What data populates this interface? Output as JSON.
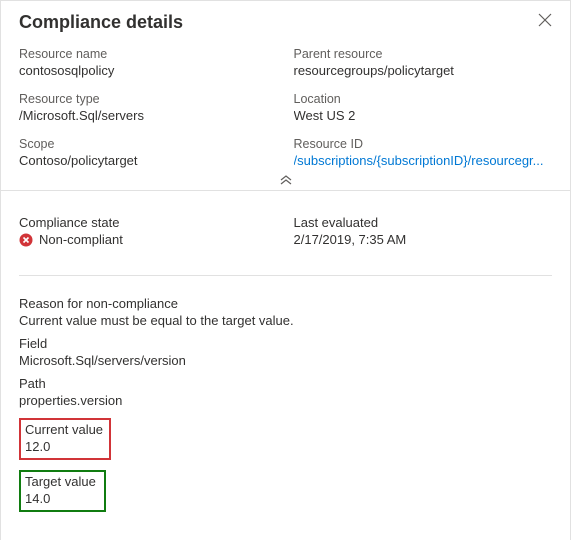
{
  "header": {
    "title": "Compliance details"
  },
  "details": {
    "resource_name": {
      "label": "Resource name",
      "value": "contososqlpolicy"
    },
    "parent_resource": {
      "label": "Parent resource",
      "value": "resourcegroups/policytarget"
    },
    "resource_type": {
      "label": "Resource type",
      "value": "/Microsoft.Sql/servers"
    },
    "location": {
      "label": "Location",
      "value": "West US 2"
    },
    "scope": {
      "label": "Scope",
      "value": "Contoso/policytarget"
    },
    "resource_id": {
      "label": "Resource ID",
      "value": "/subscriptions/{subscriptionID}/resourcegr..."
    }
  },
  "compliance": {
    "state_label": "Compliance state",
    "state_value": "Non-compliant",
    "last_evaluated_label": "Last evaluated",
    "last_evaluated_value": "2/17/2019, 7:35 AM"
  },
  "reason": {
    "heading": "Reason for non-compliance",
    "text": "Current value must be equal to the target value.",
    "field_label": "Field",
    "field_value": "Microsoft.Sql/servers/version",
    "path_label": "Path",
    "path_value": "properties.version",
    "current_label": "Current value",
    "current_value": "12.0",
    "target_label": "Target value",
    "target_value": "14.0"
  },
  "colors": {
    "link": "#0078d4",
    "error": "#d13438",
    "success": "#107c10"
  }
}
